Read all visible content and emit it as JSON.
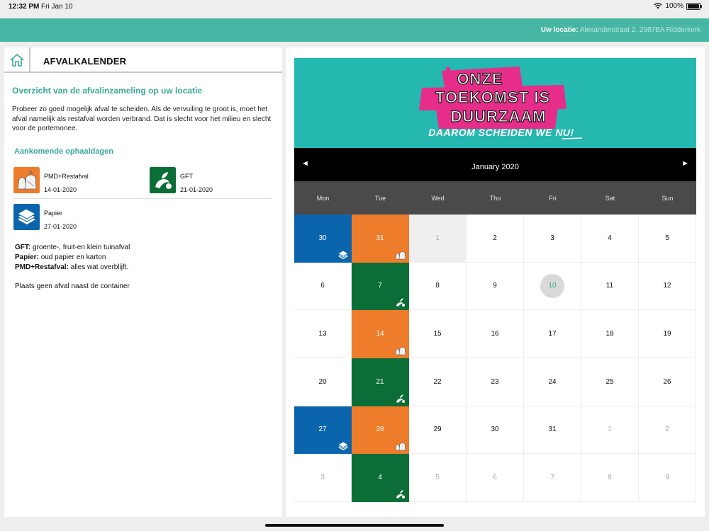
{
  "status": {
    "time": "12:32 PM",
    "date": "Fri Jan 10",
    "battery": "100%",
    "battery_level": 1.0
  },
  "topbar": {
    "location_label": "Uw locatie:",
    "location_value": "Alexanderstraat 2, 2987BA Ridderkerk"
  },
  "left": {
    "title": "AFVALKALENDER",
    "overview_title": "Overzicht van de afvalinzameling op uw locatie",
    "overview_text": "Probeer zo goed mogelijk afval te scheiden. Als de vervuiling te groot is, moet het afval namelijk als restafval worden verbrand. Dat is slecht voor het milieu en slecht voor de portemonee.",
    "upcoming_title": "Aankomende ophaaldagen",
    "pickups": [
      {
        "name": "PMD+Restafval",
        "date": "14-01-2020",
        "icon": "pmd-restafval-icon",
        "color": "#ef7c2b"
      },
      {
        "name": "GFT",
        "date": "21-01-2020",
        "icon": "gft-icon",
        "color": "#0b6e36"
      },
      {
        "name": "Papier",
        "date": "27-01-2020",
        "icon": "papier-icon",
        "color": "#0a65ad"
      }
    ],
    "legend": [
      {
        "term": "GFT:",
        "desc": "groente-, fruit-en klein tuinafval"
      },
      {
        "term": "Papier:",
        "desc": "oud papier en karton"
      },
      {
        "term": "PMD+Restafval:",
        "desc": "alles wat overblijft."
      }
    ],
    "note": "Plaats geen afval naast de container"
  },
  "banner": {
    "line1": "ONZE",
    "line2": "TOEKOMST IS",
    "line3": "DUURZAAM",
    "line4": "DAAROM SCHEIDEN WE NU!"
  },
  "calendar": {
    "month_title": "January 2020",
    "prev": "◄",
    "next": "►",
    "weekdays": [
      "Mon",
      "Tue",
      "Wed",
      "Thu",
      "Fri",
      "Sat",
      "Sun"
    ],
    "colors": {
      "papier": "#0a65ad",
      "pmd": "#ef7c2b",
      "gft": "#0b6e36",
      "today": "#3aaa98"
    },
    "weeks": [
      [
        {
          "d": "30",
          "type": "papier",
          "out": true
        },
        {
          "d": "31",
          "type": "pmd",
          "out": true
        },
        {
          "d": "1",
          "type": "holiday"
        },
        {
          "d": "2"
        },
        {
          "d": "3"
        },
        {
          "d": "4"
        },
        {
          "d": "5"
        }
      ],
      [
        {
          "d": "6"
        },
        {
          "d": "7",
          "type": "gft"
        },
        {
          "d": "8"
        },
        {
          "d": "9"
        },
        {
          "d": "10",
          "today": true
        },
        {
          "d": "11"
        },
        {
          "d": "12"
        }
      ],
      [
        {
          "d": "13"
        },
        {
          "d": "14",
          "type": "pmd"
        },
        {
          "d": "15"
        },
        {
          "d": "16"
        },
        {
          "d": "17"
        },
        {
          "d": "18"
        },
        {
          "d": "19"
        }
      ],
      [
        {
          "d": "20"
        },
        {
          "d": "21",
          "type": "gft"
        },
        {
          "d": "22"
        },
        {
          "d": "23"
        },
        {
          "d": "24"
        },
        {
          "d": "25"
        },
        {
          "d": "26"
        }
      ],
      [
        {
          "d": "27",
          "type": "papier"
        },
        {
          "d": "28",
          "type": "pmd"
        },
        {
          "d": "29"
        },
        {
          "d": "30"
        },
        {
          "d": "31"
        },
        {
          "d": "1",
          "out": true
        },
        {
          "d": "2",
          "out": true
        }
      ],
      [
        {
          "d": "3",
          "out": true
        },
        {
          "d": "4",
          "type": "gft",
          "out": true
        },
        {
          "d": "5",
          "out": true
        },
        {
          "d": "6",
          "out": true
        },
        {
          "d": "7",
          "out": true
        },
        {
          "d": "8",
          "out": true
        },
        {
          "d": "9",
          "out": true
        }
      ]
    ]
  }
}
